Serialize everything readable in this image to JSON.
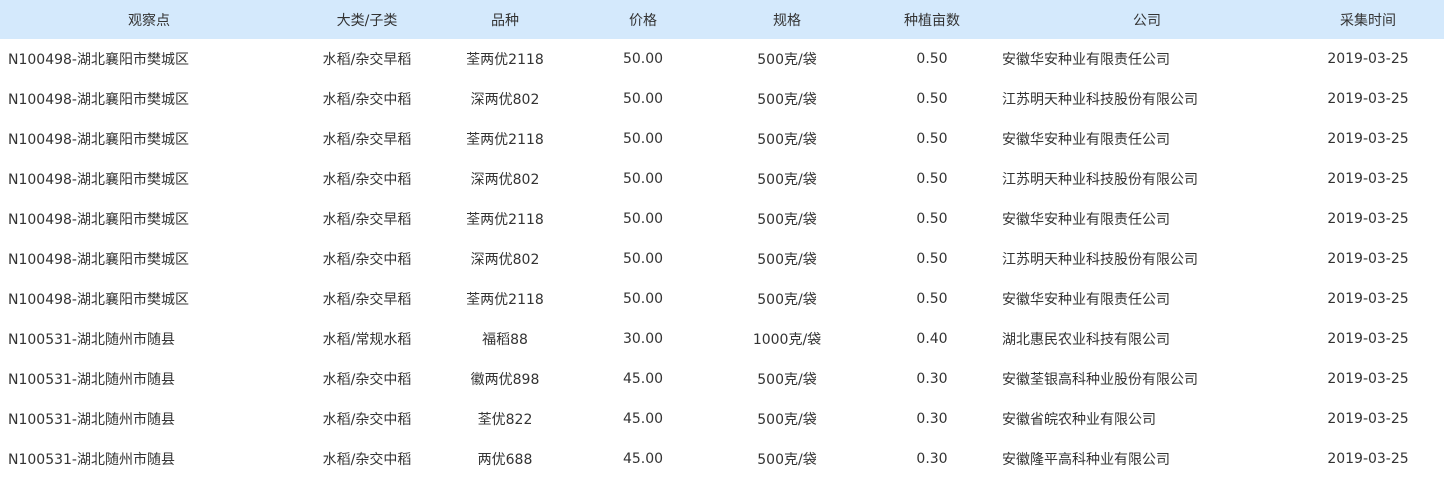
{
  "table": {
    "headers": {
      "site": "观察点",
      "category": "大类/子类",
      "variety": "品种",
      "price": "价格",
      "spec": "规格",
      "area": "种植亩数",
      "company": "公司",
      "date": "采集时间"
    },
    "rows": [
      {
        "site": "N100498-湖北襄阳市樊城区",
        "category": "水稻/杂交早稻",
        "variety": "荃两优2118",
        "price": "50.00",
        "spec": "500克/袋",
        "area": "0.50",
        "company": "安徽华安种业有限责任公司",
        "date": "2019-03-25"
      },
      {
        "site": "N100498-湖北襄阳市樊城区",
        "category": "水稻/杂交中稻",
        "variety": "深两优802",
        "price": "50.00",
        "spec": "500克/袋",
        "area": "0.50",
        "company": "江苏明天种业科技股份有限公司",
        "date": "2019-03-25"
      },
      {
        "site": "N100498-湖北襄阳市樊城区",
        "category": "水稻/杂交早稻",
        "variety": "荃两优2118",
        "price": "50.00",
        "spec": "500克/袋",
        "area": "0.50",
        "company": "安徽华安种业有限责任公司",
        "date": "2019-03-25"
      },
      {
        "site": "N100498-湖北襄阳市樊城区",
        "category": "水稻/杂交中稻",
        "variety": "深两优802",
        "price": "50.00",
        "spec": "500克/袋",
        "area": "0.50",
        "company": "江苏明天种业科技股份有限公司",
        "date": "2019-03-25"
      },
      {
        "site": "N100498-湖北襄阳市樊城区",
        "category": "水稻/杂交早稻",
        "variety": "荃两优2118",
        "price": "50.00",
        "spec": "500克/袋",
        "area": "0.50",
        "company": "安徽华安种业有限责任公司",
        "date": "2019-03-25"
      },
      {
        "site": "N100498-湖北襄阳市樊城区",
        "category": "水稻/杂交中稻",
        "variety": "深两优802",
        "price": "50.00",
        "spec": "500克/袋",
        "area": "0.50",
        "company": "江苏明天种业科技股份有限公司",
        "date": "2019-03-25"
      },
      {
        "site": "N100498-湖北襄阳市樊城区",
        "category": "水稻/杂交早稻",
        "variety": "荃两优2118",
        "price": "50.00",
        "spec": "500克/袋",
        "area": "0.50",
        "company": "安徽华安种业有限责任公司",
        "date": "2019-03-25"
      },
      {
        "site": "N100531-湖北随州市随县",
        "category": "水稻/常规水稻",
        "variety": "福稻88",
        "price": "30.00",
        "spec": "1000克/袋",
        "area": "0.40",
        "company": "湖北惠民农业科技有限公司",
        "date": "2019-03-25"
      },
      {
        "site": "N100531-湖北随州市随县",
        "category": "水稻/杂交中稻",
        "variety": "徽两优898",
        "price": "45.00",
        "spec": "500克/袋",
        "area": "0.30",
        "company": "安徽荃银高科种业股份有限公司",
        "date": "2019-03-25"
      },
      {
        "site": "N100531-湖北随州市随县",
        "category": "水稻/杂交中稻",
        "variety": "荃优822",
        "price": "45.00",
        "spec": "500克/袋",
        "area": "0.30",
        "company": "安徽省皖农种业有限公司",
        "date": "2019-03-25"
      },
      {
        "site": "N100531-湖北随州市随县",
        "category": "水稻/杂交中稻",
        "variety": "两优688",
        "price": "45.00",
        "spec": "500克/袋",
        "area": "0.30",
        "company": "安徽隆平高科种业有限公司",
        "date": "2019-03-25"
      }
    ]
  },
  "colors": {
    "header_bg": "#d4e9fc",
    "text": "#333333"
  }
}
